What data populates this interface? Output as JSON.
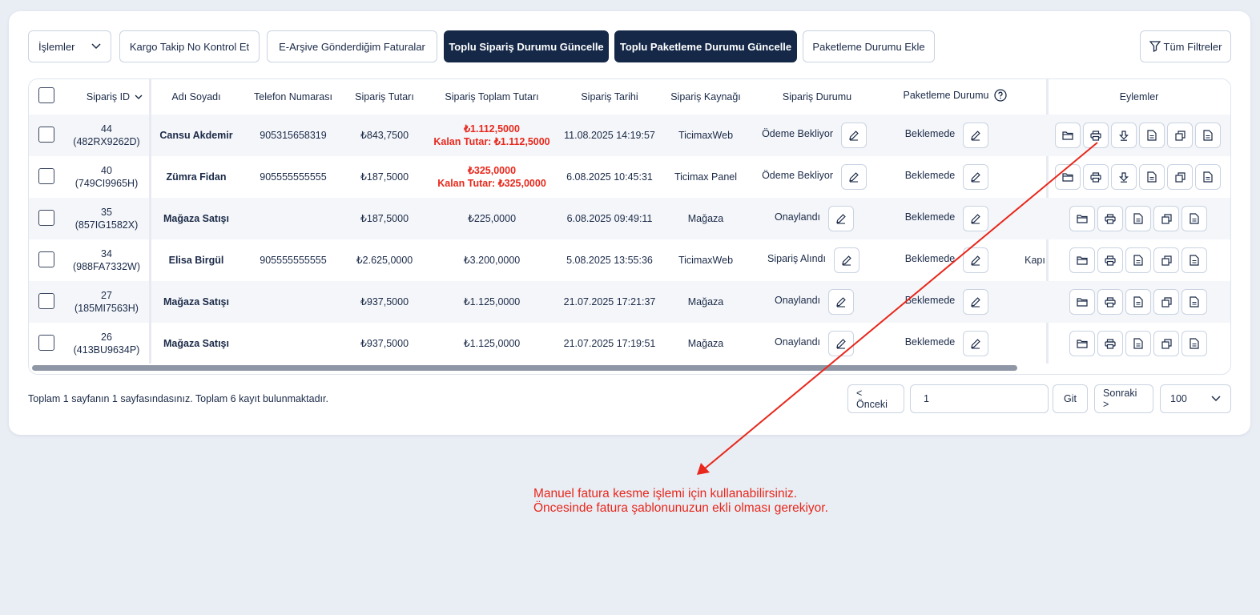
{
  "toolbar": {
    "actions_select": "İşlemler",
    "cargo_check": "Kargo Takip No Kontrol Et",
    "earsiv": "E-Arşive Gönderdiğim Faturalar",
    "bulk_order_status": "Toplu Sipariş Durumu Güncelle",
    "bulk_pack_status": "Toplu Paketleme Durumu Güncelle",
    "add_pack_status": "Paketleme Durumu Ekle",
    "all_filters": "Tüm Filtreler"
  },
  "columns": {
    "order_id": "Sipariş ID",
    "name": "Adı Soyadı",
    "phone": "Telefon Numarası",
    "amount": "Sipariş Tutarı",
    "total": "Sipariş Toplam Tutarı",
    "date": "Sipariş Tarihi",
    "source": "Sipariş Kaynağı",
    "status": "Sipariş Durumu",
    "pack": "Paketleme Durumu",
    "actions": "Eylemler"
  },
  "rows": [
    {
      "id": "44",
      "code": "(482RX9262D)",
      "name": "Cansu Akdemir",
      "phone": "905315658319",
      "amount": "₺843,7500",
      "total": "₺1.112,5000",
      "remaining": "Kalan Tutar: ₺1.112,5000",
      "date": "11.08.2025 14:19:57",
      "source": "TicimaxWeb",
      "status": "Ödeme Bekliyor",
      "pack": "Beklemede",
      "extra": ""
    },
    {
      "id": "40",
      "code": "(749CI9965H)",
      "name": "Zümra Fidan",
      "phone": "905555555555",
      "amount": "₺187,5000",
      "total": "₺325,0000",
      "remaining": "Kalan Tutar: ₺325,0000",
      "date": "6.08.2025 10:45:31",
      "source": "Ticimax Panel",
      "status": "Ödeme Bekliyor",
      "pack": "Beklemede",
      "extra": ""
    },
    {
      "id": "35",
      "code": "(857IG1582X)",
      "name": "Mağaza Satışı",
      "phone": "",
      "amount": "₺187,5000",
      "total": "₺225,0000",
      "remaining": "",
      "date": "6.08.2025 09:49:11",
      "source": "Mağaza",
      "status": "Onaylandı",
      "pack": "Beklemede",
      "extra": ""
    },
    {
      "id": "34",
      "code": "(988FA7332W)",
      "name": "Elisa Birgül",
      "phone": "905555555555",
      "amount": "₺2.625,0000",
      "total": "₺3.200,0000",
      "remaining": "",
      "date": "5.08.2025 13:55:36",
      "source": "TicimaxWeb",
      "status": "Sipariş Alındı",
      "pack": "Beklemede",
      "extra": "Kapı"
    },
    {
      "id": "27",
      "code": "(185MI7563H)",
      "name": "Mağaza Satışı",
      "phone": "",
      "amount": "₺937,5000",
      "total": "₺1.125,0000",
      "remaining": "",
      "date": "21.07.2025 17:21:37",
      "source": "Mağaza",
      "status": "Onaylandı",
      "pack": "Beklemede",
      "extra": ""
    },
    {
      "id": "26",
      "code": "(413BU9634P)",
      "name": "Mağaza Satışı",
      "phone": "",
      "amount": "₺937,5000",
      "total": "₺1.125,0000",
      "remaining": "",
      "date": "21.07.2025 17:19:51",
      "source": "Mağaza",
      "status": "Onaylandı",
      "pack": "Beklemede",
      "extra": ""
    }
  ],
  "footer": {
    "summary": "Toplam 1 sayfanın 1 sayfasındasınız. Toplam 6 kayıt bulunmaktadır.",
    "prev": "< Önceki",
    "page_value": "1",
    "go": "Git",
    "next": "Sonraki >",
    "per_page": "100"
  },
  "annotation": {
    "line1": "Manuel fatura kesme işlemi için kullanabilirsiniz.",
    "line2": "Öncesinde fatura şablonunuzun ekli olması gerekiyor."
  },
  "colors": {
    "navy": "#152848",
    "red": "#e8281c",
    "border": "#c9d3e2"
  }
}
